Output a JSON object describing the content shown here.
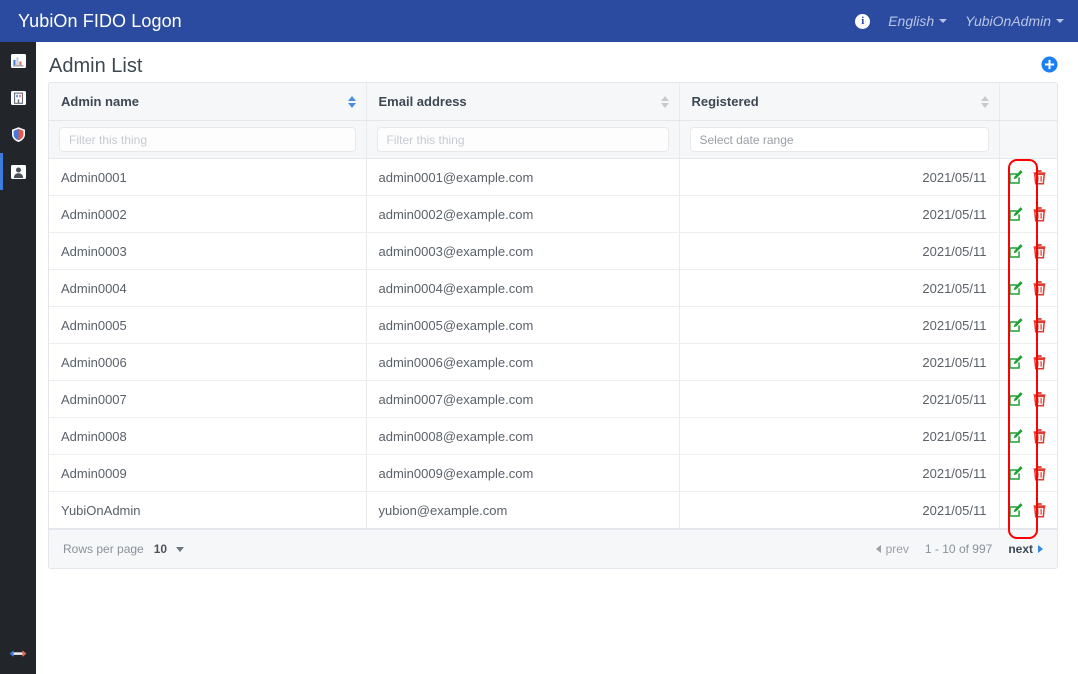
{
  "navbar": {
    "brand": "YubiOn FIDO Logon",
    "info_icon": "info-circle-icon",
    "language": "English",
    "account": "YubiOnAdmin"
  },
  "sidebar": {
    "items": [
      {
        "icon": "chart-bar-icon",
        "active": false
      },
      {
        "icon": "building-icon",
        "active": false
      },
      {
        "icon": "shield-icon",
        "active": false
      },
      {
        "icon": "user-icon",
        "active": true
      }
    ],
    "bottom": {
      "icon": "arrows-left-right-icon"
    }
  },
  "page": {
    "title": "Admin List",
    "add_button": "add-circle-icon"
  },
  "table": {
    "columns": [
      {
        "label": "Admin name",
        "sort": "active"
      },
      {
        "label": "Email address",
        "sort": "inactive"
      },
      {
        "label": "Registered",
        "sort": "inactive"
      },
      {
        "label": "",
        "sort": "none"
      }
    ],
    "filters": {
      "admin_name_placeholder": "Filter this thing",
      "email_placeholder": "Filter this thing",
      "registered_placeholder": "Select date range"
    },
    "rows": [
      {
        "name": "Admin0001",
        "email": "admin0001@example.com",
        "registered": "2021/05/11"
      },
      {
        "name": "Admin0002",
        "email": "admin0002@example.com",
        "registered": "2021/05/11"
      },
      {
        "name": "Admin0003",
        "email": "admin0003@example.com",
        "registered": "2021/05/11"
      },
      {
        "name": "Admin0004",
        "email": "admin0004@example.com",
        "registered": "2021/05/11"
      },
      {
        "name": "Admin0005",
        "email": "admin0005@example.com",
        "registered": "2021/05/11"
      },
      {
        "name": "Admin0006",
        "email": "admin0006@example.com",
        "registered": "2021/05/11"
      },
      {
        "name": "Admin0007",
        "email": "admin0007@example.com",
        "registered": "2021/05/11"
      },
      {
        "name": "Admin0008",
        "email": "admin0008@example.com",
        "registered": "2021/05/11"
      },
      {
        "name": "Admin0009",
        "email": "admin0009@example.com",
        "registered": "2021/05/11"
      },
      {
        "name": "YubiOnAdmin",
        "email": "yubion@example.com",
        "registered": "2021/05/11"
      }
    ],
    "row_actions": {
      "edit": "edit-pencil-icon",
      "delete": "trash-icon"
    }
  },
  "footer": {
    "rows_per_page_label": "Rows per page",
    "rows_per_page_value": "10",
    "prev_label": "prev",
    "range_label": "1 - 10 of 997",
    "next_label": "next"
  },
  "colors": {
    "navbar_blue": "#2b4ba0",
    "sidebar_dark": "#22252a",
    "accent_blue": "#3e7bdd",
    "edit_green": "#21a038",
    "delete_red": "#e0392e",
    "annotation_red": "#ff0000"
  }
}
